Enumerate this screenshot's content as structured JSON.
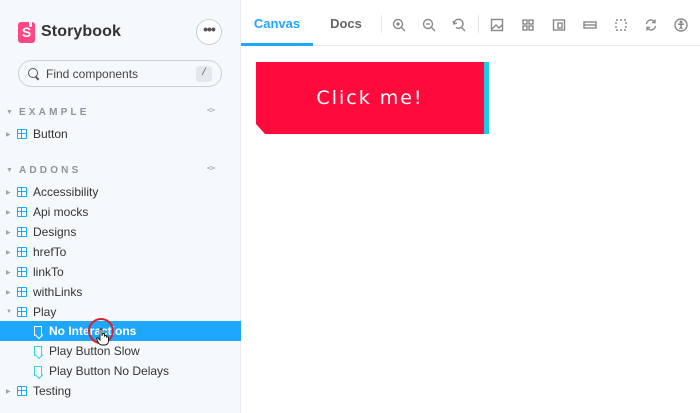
{
  "app": {
    "name": "Storybook"
  },
  "sidebar": {
    "menu_label": "•••",
    "search": {
      "placeholder": "Find components",
      "shortcut": "/"
    },
    "sections": [
      {
        "title": "EXAMPLE",
        "items": [
          {
            "label": "Button"
          }
        ]
      },
      {
        "title": "ADDONS",
        "items": [
          {
            "label": "Accessibility"
          },
          {
            "label": "Api mocks"
          },
          {
            "label": "Designs"
          },
          {
            "label": "hrefTo"
          },
          {
            "label": "linkTo"
          },
          {
            "label": "withLinks"
          },
          {
            "label": "Play",
            "expanded": true,
            "children": [
              {
                "label": "No Interactions",
                "selected": true
              },
              {
                "label": "Play Button Slow"
              },
              {
                "label": "Play Button No Delays"
              }
            ]
          },
          {
            "label": "Testing"
          }
        ]
      }
    ]
  },
  "toolbar": {
    "tabs": [
      {
        "label": "Canvas",
        "active": true
      },
      {
        "label": "Docs"
      }
    ],
    "tools": [
      "zoom-in-icon",
      "zoom-out-icon",
      "zoom-reset-icon",
      "background-icon",
      "grid-icon",
      "viewport-icon",
      "measure-icon",
      "outline-icon",
      "remount-icon",
      "a11y-icon"
    ]
  },
  "canvas": {
    "button": {
      "label": "Click me!",
      "color": "#ff0a3c",
      "edge_color": "#1ec8e6"
    }
  },
  "colors": {
    "accent": "#1ea7fd",
    "brand": "#ff4785",
    "story": "#37d5d3"
  }
}
